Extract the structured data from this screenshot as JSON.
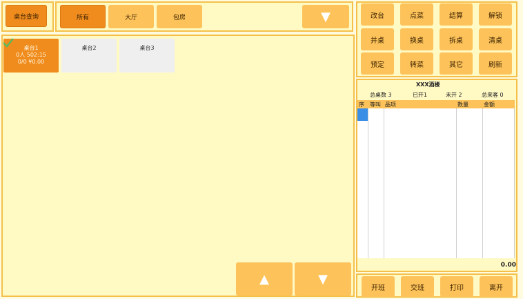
{
  "toolbar": {
    "query_label": "桌台查询",
    "filters": [
      "所有",
      "大厅",
      "包房"
    ]
  },
  "tables": [
    {
      "name": "桌台1",
      "line2": "0人 502:15",
      "line3": "0/0 ¥0.00",
      "status": "active"
    },
    {
      "name": "桌台2",
      "status": "idle"
    },
    {
      "name": "桌台3",
      "status": "idle"
    }
  ],
  "actions": [
    "改台",
    "点菜",
    "结算",
    "解锁",
    "并桌",
    "换桌",
    "拆桌",
    "清桌",
    "预定",
    "转菜",
    "其它",
    "刷新"
  ],
  "summary": {
    "restaurant": "XXX酒楼",
    "total": "总桌数 3",
    "opened": "已开1",
    "unopened": "未开 2",
    "guests": "总来客 0"
  },
  "grid": {
    "columns": [
      "序",
      "等叫",
      "品项",
      "数量",
      "金额"
    ],
    "total": "0.00"
  },
  "bottom_actions": [
    "开班",
    "交班",
    "打印",
    "离开"
  ],
  "colors": {
    "accent": "#f08c1e",
    "button": "#fdc35a",
    "background": "#fff9c4",
    "checkmark": "#5cb85c"
  }
}
